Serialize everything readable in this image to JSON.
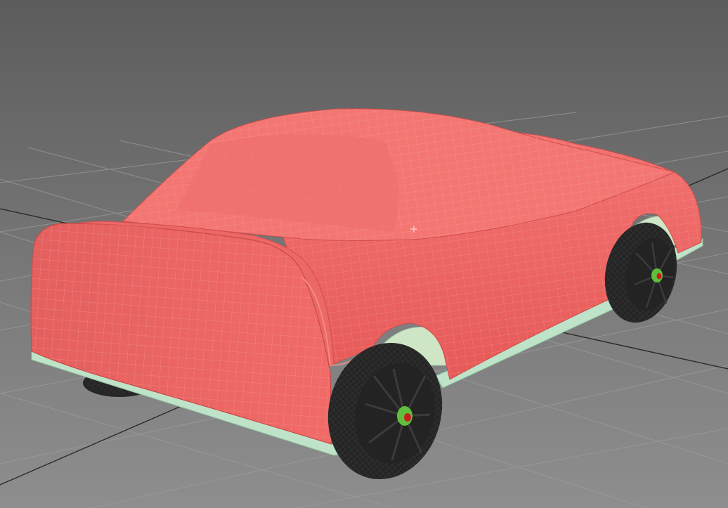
{
  "viewport": {
    "name": "perspective-viewport",
    "shading": "shaded-with-wireframe-edges",
    "background": "#6e6e6e"
  },
  "colors": {
    "car_body": "#f06a68",
    "car_body_shade": "#d85452",
    "wire": "#f49a96",
    "rocker_panel": "#bfe3c8",
    "tire": "#2a2a2a",
    "hub_green": "#5fbf3c",
    "hub_red": "#c81e1e",
    "grid_line": "#9a9a9a",
    "grid_axis": "#2d2d2d"
  },
  "model": {
    "object": "car-body",
    "wheels": [
      "rear-left-wheel",
      "rear-right-wheel",
      "front-right-wheel",
      "front-left-wheel"
    ]
  },
  "cursor": {
    "icon": "crosshair-cursor-icon"
  }
}
